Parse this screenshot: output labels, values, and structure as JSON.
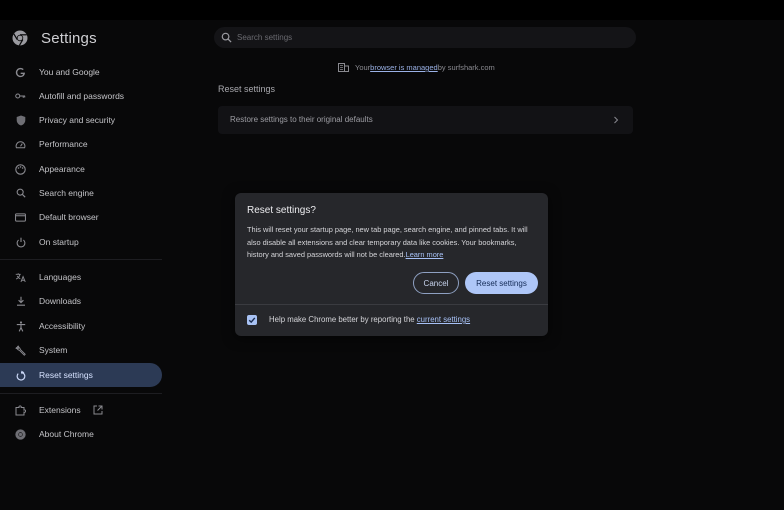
{
  "header": {
    "title": "Settings",
    "search_placeholder": "Search settings"
  },
  "sidebar": {
    "items": [
      {
        "label": "You and Google",
        "icon": "google-g-icon"
      },
      {
        "label": "Autofill and passwords",
        "icon": "key-icon"
      },
      {
        "label": "Privacy and security",
        "icon": "shield-icon"
      },
      {
        "label": "Performance",
        "icon": "speedometer-icon"
      },
      {
        "label": "Appearance",
        "icon": "palette-icon"
      },
      {
        "label": "Search engine",
        "icon": "search-icon"
      },
      {
        "label": "Default browser",
        "icon": "browser-window-icon"
      },
      {
        "label": "On startup",
        "icon": "power-icon"
      },
      {
        "label": "Languages",
        "icon": "translate-icon"
      },
      {
        "label": "Downloads",
        "icon": "download-icon"
      },
      {
        "label": "Accessibility",
        "icon": "accessibility-icon"
      },
      {
        "label": "System",
        "icon": "wrench-icon"
      },
      {
        "label": "Reset settings",
        "icon": "reset-icon",
        "active": true
      },
      {
        "label": "Extensions",
        "icon": "puzzle-icon"
      },
      {
        "label": "About Chrome",
        "icon": "chrome-icon"
      }
    ]
  },
  "managed": {
    "prefix": "Your ",
    "link": "browser is managed",
    "suffix": " by surfshark.com"
  },
  "main": {
    "section_title": "Reset settings",
    "restore_label": "Restore settings to their original defaults"
  },
  "dialog": {
    "title": "Reset settings?",
    "body": "This will reset your startup page, new tab page, search engine, and pinned tabs. It will also disable all extensions and clear temporary data like cookies. Your bookmarks, history and saved passwords will not be cleared.",
    "learn_more": "Learn more",
    "cancel_label": "Cancel",
    "reset_label": "Reset settings",
    "checkbox_label": "Help make Chrome better by reporting the ",
    "checkbox_link": "current settings",
    "checkbox_checked": true
  },
  "colors": {
    "accent": "#aec6f7",
    "active_nav": "#2c3a55",
    "link": "#a6c0f5"
  }
}
